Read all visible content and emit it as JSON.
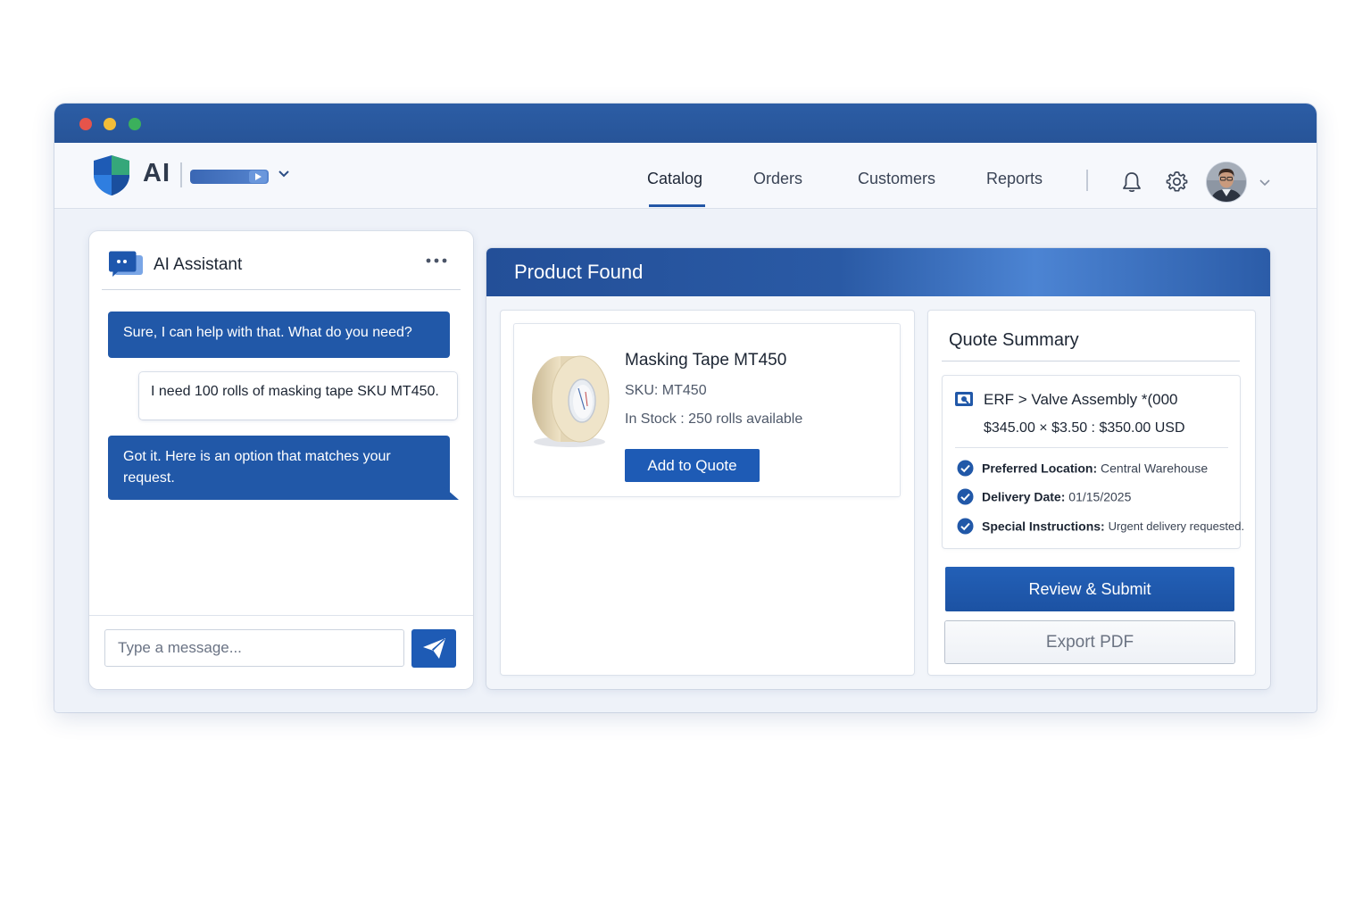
{
  "window": {
    "traffic_lights": {
      "red": "#e5544b",
      "yellow": "#f3bd38",
      "green": "#3bb05c"
    }
  },
  "navbar": {
    "brand": "AI",
    "tabs": [
      {
        "label": "Catalog",
        "active": true
      },
      {
        "label": "Orders",
        "active": false
      },
      {
        "label": "Customers",
        "active": false
      },
      {
        "label": "Reports",
        "active": false
      }
    ],
    "icons": [
      "shield-logo-icon",
      "chevron-down-icon",
      "bell-icon",
      "gear-icon",
      "avatar",
      "chevron-down-icon"
    ]
  },
  "chat": {
    "title": "AI Assistant",
    "messages": [
      {
        "from": "assistant",
        "text": "Sure, I can help with that. What do you need?"
      },
      {
        "from": "user",
        "text": "I need 100 rolls of masking tape SKU MT450."
      },
      {
        "from": "assistant",
        "text": "Got it. Here is an option that matches your request."
      }
    ],
    "input_placeholder": "Type a message..."
  },
  "product": {
    "header": "Product Found",
    "name": "Masking Tape MT450",
    "sku": "SKU:  MT450",
    "stock": "In Stock : 250 rolls available",
    "add_button": "Add to Quote"
  },
  "quote": {
    "title": "Quote Summary",
    "line_item": "ERF  >  Valve Assembly *(000",
    "price_line": "$345.00  ×  $3.50  :  $350.00 USD",
    "details": [
      {
        "label": "Preferred Location:",
        "value": "Central Warehouse"
      },
      {
        "label": "Delivery Date:",
        "value": "01/15/2025"
      },
      {
        "label": "Special Instructions:",
        "value": "Urgent delivery requested."
      }
    ],
    "review_button": "Review & Submit",
    "export_button": "Export PDF"
  },
  "colors": {
    "accent": "#1e5bb5",
    "titlebar": "#2a5aa3",
    "bot_bubble": "#2158a8"
  }
}
